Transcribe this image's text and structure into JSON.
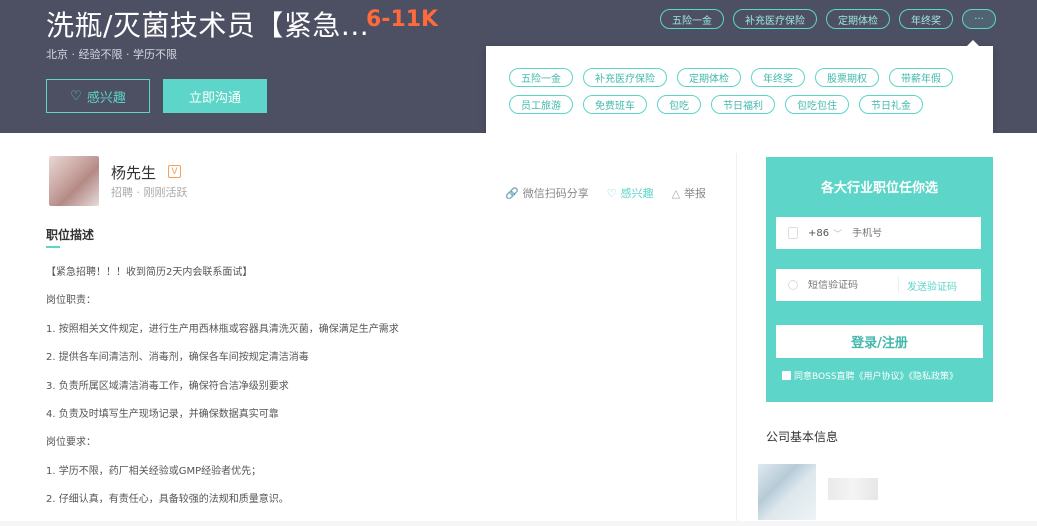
{
  "job": {
    "title": "洗瓶/灭菌技术员【紧急...",
    "salary": "6-11K",
    "meta": "北京 · 经验不限 · 学历不限",
    "interest_button": "感兴趣",
    "chat_button": "立即沟通"
  },
  "header_tags": [
    "五险一金",
    "补充医疗保险",
    "定期体检",
    "年终奖"
  ],
  "more_label": "···",
  "popup_tags": {
    "row1": [
      "五险一金",
      "补充医疗保险",
      "定期体检",
      "年终奖",
      "股票期权",
      "带薪年假"
    ],
    "row2": [
      "员工旅游",
      "免费班车",
      "包吃",
      "节日福利",
      "包吃包住",
      "节日礼金"
    ]
  },
  "recruiter": {
    "name": "杨先生",
    "badge": "V",
    "status": "招聘 · 刚刚活跃"
  },
  "actions": {
    "share": "微信扫码分享",
    "favorite": "感兴趣",
    "report": "举报"
  },
  "section": {
    "title": "职位描述"
  },
  "description": [
    "【紧急招聘！！！收到简历2天内会联系面试】",
    "岗位职责：",
    "1. 按照相关文件规定，进行生产用西林瓶或容器具清洗灭菌，确保满足生产需求",
    "2. 提供各车间清洁剂、消毒剂，确保各车间按规定清洁消毒",
    "3. 负责所属区域清洁消毒工作，确保符合洁净级别要求",
    "4. 负责及时填写生产现场记录，并确保数据真实可靠",
    "岗位要求：",
    "1. 学历不限，药厂相关经验或GMP经验者优先；",
    "2. 仔细认真，有责任心，具备较强的法规和质量意识。"
  ],
  "login_panel": {
    "title": "各大行业职位任你选",
    "country_code": "+86",
    "phone_placeholder": "手机号",
    "code_placeholder": "短信验证码",
    "send_code": "发送验证码",
    "login_button": "登录/注册",
    "agreement": "同意BOSS直聘《用户协议》《隐私政策》"
  },
  "company": {
    "label": "公司基本信息"
  },
  "colors": {
    "accent": "#5dd5c8",
    "salary": "#ff6a3d",
    "header_bg": "#4d4f63"
  }
}
